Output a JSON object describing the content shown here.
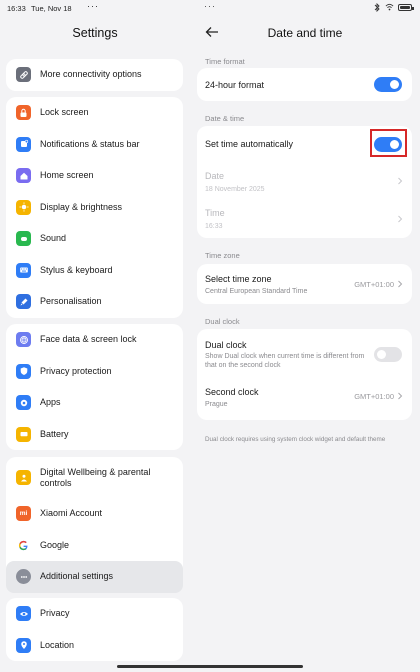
{
  "status_bar": {
    "time": "16:33",
    "date": "Tue, Nov 18",
    "dots_left": "···",
    "dots_center": "···"
  },
  "left": {
    "title": "Settings",
    "groups": [
      {
        "items": [
          {
            "label": "More connectivity options",
            "icon": "link-icon",
            "color": "#6b6f7a"
          }
        ]
      },
      {
        "items": [
          {
            "label": "Lock screen",
            "icon": "lock-icon",
            "color": "#f0642a"
          },
          {
            "label": "Notifications & status bar",
            "icon": "notification-icon",
            "color": "#2f7df6"
          },
          {
            "label": "Home screen",
            "icon": "home-icon",
            "color": "#7a6cf0"
          },
          {
            "label": "Display & brightness",
            "icon": "sun-icon",
            "color": "#f5b400"
          },
          {
            "label": "Sound",
            "icon": "sound-icon",
            "color": "#29b84f"
          },
          {
            "label": "Stylus & keyboard",
            "icon": "keyboard-icon",
            "color": "#2f7df6"
          },
          {
            "label": "Personalisation",
            "icon": "brush-icon",
            "color": "#2f6fe0"
          }
        ]
      },
      {
        "items": [
          {
            "label": "Face data & screen lock",
            "icon": "fingerprint-icon",
            "color": "#6d7cf0"
          },
          {
            "label": "Privacy protection",
            "icon": "privacy-icon",
            "color": "#2f7df6"
          },
          {
            "label": "Apps",
            "icon": "gear-icon",
            "color": "#2f7df6"
          },
          {
            "label": "Battery",
            "icon": "battery-icon",
            "color": "#f5b400"
          }
        ]
      },
      {
        "items": [
          {
            "label": "Digital Wellbeing & parental controls",
            "icon": "wellbeing-icon",
            "color": "#f5b400"
          },
          {
            "label": "Xiaomi Account",
            "icon": "xiaomi-icon",
            "color": "#f0642a"
          },
          {
            "label": "Google",
            "icon": "google-icon",
            "color": "#ffffff"
          },
          {
            "label": "Additional settings",
            "icon": "more-icon",
            "color": "#8a8e99"
          }
        ]
      },
      {
        "items": [
          {
            "label": "Privacy",
            "icon": "eye-icon",
            "color": "#2f7df6"
          },
          {
            "label": "Location",
            "icon": "location-icon",
            "color": "#2f7df6"
          }
        ]
      }
    ]
  },
  "right": {
    "title": "Date and time",
    "time_format": {
      "section": "Time format",
      "hour24_label": "24-hour format",
      "hour24_on": true
    },
    "date_time": {
      "section": "Date & time",
      "auto_label": "Set time automatically",
      "auto_on": true,
      "date_label": "Date",
      "date_value": "18 November 2025",
      "time_label": "Time",
      "time_value": "16:33"
    },
    "time_zone": {
      "section": "Time zone",
      "select_label": "Select time zone",
      "select_sub": "Central European Standard Time",
      "select_value": "GMT+01:00"
    },
    "dual_clock": {
      "section": "Dual clock",
      "dual_label": "Dual clock",
      "dual_sub": "Show Dual clock when current time is different from that on the second clock",
      "dual_on": false,
      "second_label": "Second clock",
      "second_sub": "Prague",
      "second_value": "GMT+01:00"
    },
    "footnote": "Dual clock requires using system clock widget and default theme"
  }
}
